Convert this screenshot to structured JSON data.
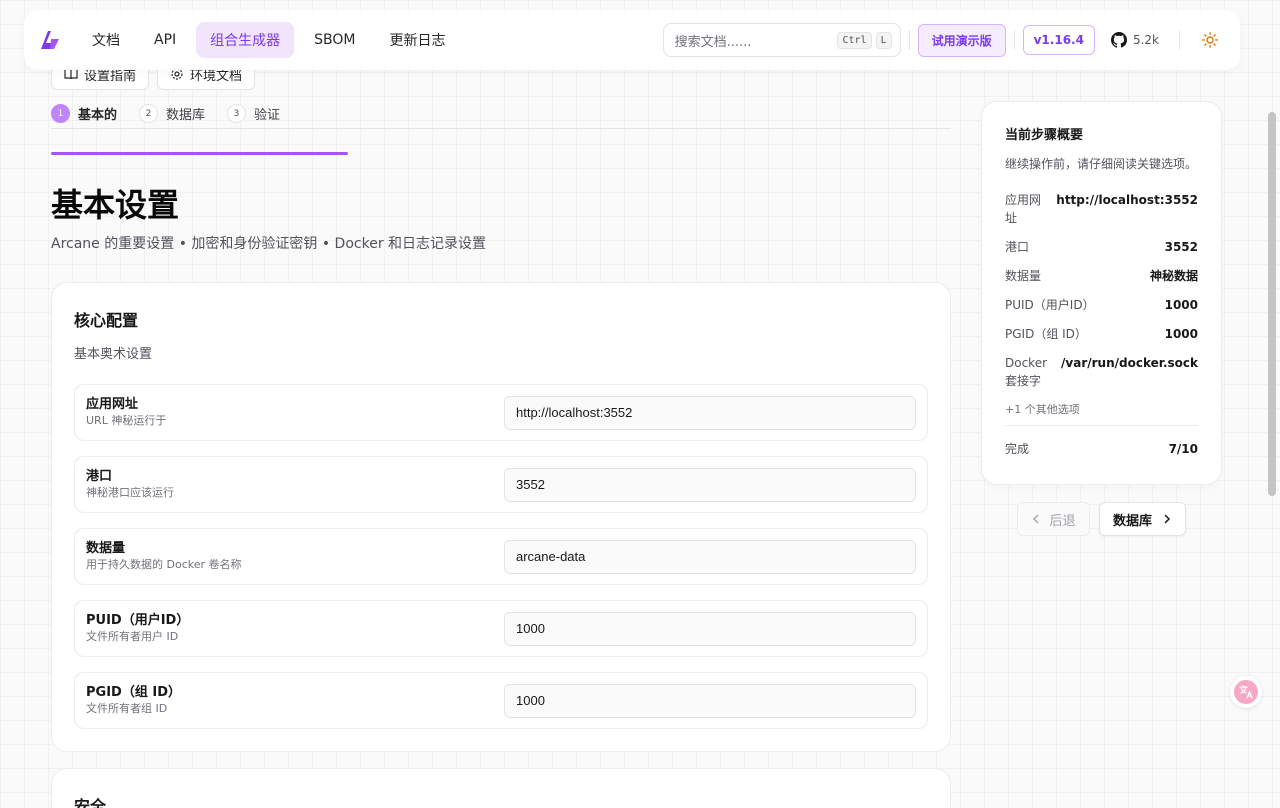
{
  "nav": {
    "links": [
      {
        "label": "文档"
      },
      {
        "label": "API"
      },
      {
        "label": "组合生成器"
      },
      {
        "label": "SBOM"
      },
      {
        "label": "更新日志"
      }
    ],
    "search_placeholder": "搜索文档......",
    "kbd": [
      "Ctrl",
      "L"
    ],
    "demo_label": "试用演示版",
    "version": "v1.16.4",
    "github_stars": "5.2k"
  },
  "guides": {
    "setup": "设置指南",
    "env": "环境文档"
  },
  "steps": [
    {
      "num": "1",
      "label": "基本的"
    },
    {
      "num": "2",
      "label": "数据库"
    },
    {
      "num": "3",
      "label": "验证"
    }
  ],
  "page": {
    "title": "基本设置",
    "subtitle": "Arcane 的重要设置 • 加密和身份验证密钥 • Docker 和日志记录设置"
  },
  "core": {
    "title": "核心配置",
    "desc": "基本奥术设置",
    "fields": [
      {
        "label": "应用网址",
        "hint": "URL 神秘运行于",
        "value": "http://localhost:3552"
      },
      {
        "label": "港口",
        "hint": "神秘港口应该运行",
        "value": "3552"
      },
      {
        "label": "数据量",
        "hint": "用于持久数据的 Docker 卷名称",
        "value": "arcane-data"
      },
      {
        "label": "PUID（用户ID）",
        "hint": "文件所有者用户 ID",
        "value": "1000"
      },
      {
        "label": "PGID（组 ID）",
        "hint": "文件所有者组 ID",
        "value": "1000"
      }
    ]
  },
  "security": {
    "title": "安全"
  },
  "summary": {
    "title": "当前步骤概要",
    "desc": "继续操作前，请仔细阅读关键选项。",
    "rows": [
      {
        "k": "应用网址",
        "v": "http://localhost:3552"
      },
      {
        "k": "港口",
        "v": "3552"
      },
      {
        "k": "数据量",
        "v": "神秘数据"
      },
      {
        "k": "PUID（用户ID）",
        "v": "1000"
      },
      {
        "k": "PGID（组 ID）",
        "v": "1000"
      },
      {
        "k": "Docker 套接字",
        "v": "/var/run/docker.sock"
      }
    ],
    "more": "+1 个其他选项",
    "done_label": "完成",
    "done_value": "7/10"
  },
  "pager": {
    "back": "后退",
    "next": "数据库"
  },
  "progress": 0.33,
  "colors": {
    "accent": "#a855f7",
    "accent_text": "#7c3aed"
  }
}
